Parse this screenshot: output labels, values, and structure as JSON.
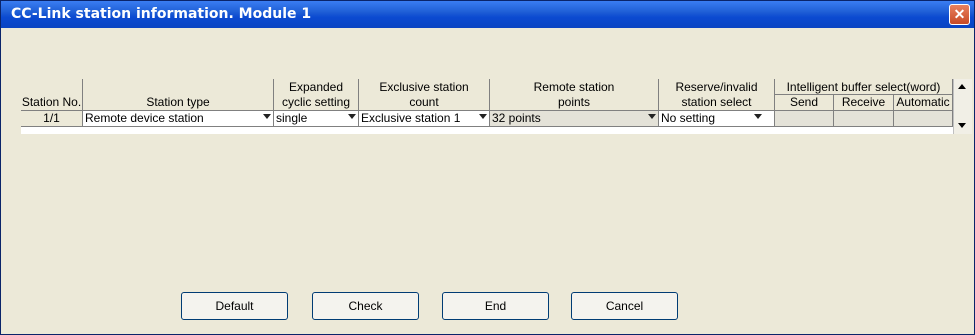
{
  "window": {
    "title": "CC-Link station information. Module 1",
    "close_glyph": "✕"
  },
  "table": {
    "headers": {
      "station_no": "Station No.",
      "station_type": "Station type",
      "expanded_top": "Expanded",
      "expanded_bottom": "cyclic setting",
      "exclusive_top": "Exclusive station",
      "exclusive_bottom": "count",
      "remote_top": "Remote station",
      "remote_bottom": "points",
      "reserve_top": "Reserve/invalid",
      "reserve_bottom": "station select",
      "intelligent": "Intelligent buffer select(word)",
      "send": "Send",
      "receive": "Receive",
      "automatic": "Automatic"
    },
    "rows": [
      {
        "station_no": "1/1",
        "station_type": "Remote device station",
        "expanded": "single",
        "exclusive": "Exclusive station 1",
        "remote_points": "32 points",
        "reserve": "No setting",
        "send": "",
        "receive": "",
        "automatic": ""
      }
    ]
  },
  "buttons": {
    "default": "Default",
    "check": "Check",
    "end": "End",
    "cancel": "Cancel"
  }
}
